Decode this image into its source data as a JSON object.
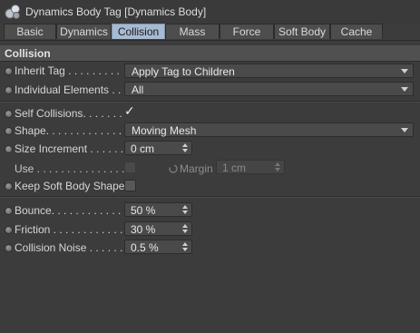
{
  "window": {
    "title": "Dynamics Body Tag [Dynamics Body]",
    "icon": "dynamics-body-tag-icon"
  },
  "tabs": [
    {
      "label": "Basic",
      "active": false
    },
    {
      "label": "Dynamics",
      "active": false
    },
    {
      "label": "Collision",
      "active": true
    },
    {
      "label": "Mass",
      "active": false
    },
    {
      "label": "Force",
      "active": false
    },
    {
      "label": "Soft Body",
      "active": false
    },
    {
      "label": "Cache",
      "active": false
    }
  ],
  "section": {
    "title": "Collision"
  },
  "fields": {
    "inherit_tag": {
      "label": "Inherit Tag . . . . . . . . .",
      "value": "Apply Tag to Children"
    },
    "individual_elements": {
      "label": "Individual Elements . .",
      "value": "All"
    },
    "self_collisions": {
      "label": "Self Collisions. . . . . . .",
      "value": "✓",
      "checked": true
    },
    "shape": {
      "label": "Shape. . . . . . . . . . . . . .",
      "value": "Moving Mesh"
    },
    "size_increment": {
      "label": "Size Increment . . . . . .",
      "value": "0 cm"
    },
    "use": {
      "label": "Use . . . . . . . . . . . . . . .",
      "checked": false
    },
    "margin": {
      "label": "Margin",
      "value": "1 cm"
    },
    "keep_soft_body_shape": {
      "label": "Keep Soft Body Shape",
      "checked": false
    },
    "bounce": {
      "label": "Bounce. . . . . . . . . . . . .",
      "value": "50 %"
    },
    "friction": {
      "label": "Friction . . . . . . . . . . . .",
      "value": "30 %"
    },
    "collision_noise": {
      "label": "Collision Noise . . . . . .",
      "value": "0.5 %"
    }
  },
  "colors": {
    "background": "#3c3c3c",
    "active_tab": "#a7bad2",
    "section_header": "#505050",
    "field": "#4a4a4a"
  }
}
